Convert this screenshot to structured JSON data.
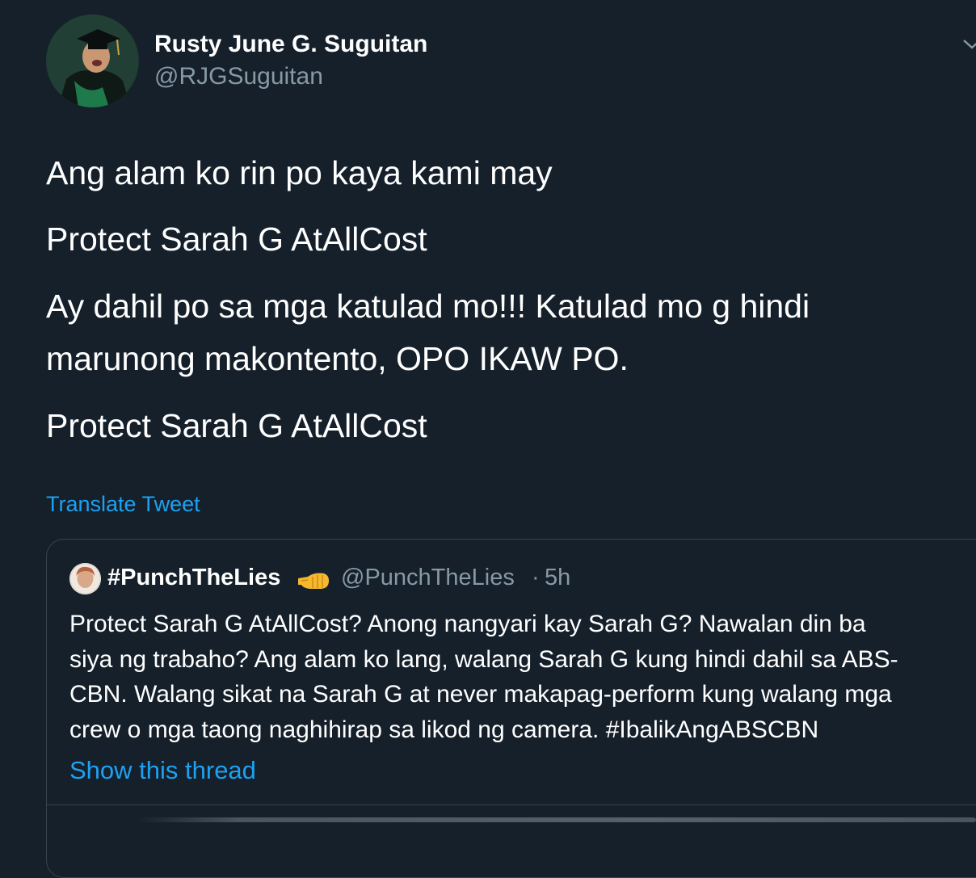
{
  "author": {
    "name": "Rusty June G. Suguitan",
    "handle": "@RJGSuguitan"
  },
  "tweet": {
    "lines": [
      "Ang alam ko rin po kaya kami may",
      "Protect Sarah G AtAllCost",
      "Ay dahil po sa mga katulad mo!!! Katulad mo g hindi",
      "marunong makontento, OPO IKAW PO.",
      "Protect Sarah G AtAllCost"
    ],
    "translate_label": "Translate Tweet"
  },
  "quote": {
    "name": "#PunchTheLies",
    "handle": "@PunchTheLies",
    "separator": "·",
    "time": "5h",
    "lines": [
      "Protect Sarah G AtAllCost? Anong nangyari kay Sarah G? Nawalan din ba",
      "siya ng trabaho? Ang alam ko lang, walang Sarah G kung hindi dahil sa ABS-",
      "CBN. Walang sikat na Sarah G at never makapag-perform kung walang mga",
      "crew o mga taong naghihirap sa likod ng camera. #IbalikAngABSCBN"
    ],
    "show_thread_label": "Show this thread"
  },
  "colors": {
    "background": "#15202b",
    "text": "#ffffff",
    "secondary_text": "#8899a6",
    "link": "#1da1f2",
    "border": "#38444d"
  },
  "icons": {
    "more": "chevron-down-icon",
    "quote_emoji": "fist-icon"
  }
}
